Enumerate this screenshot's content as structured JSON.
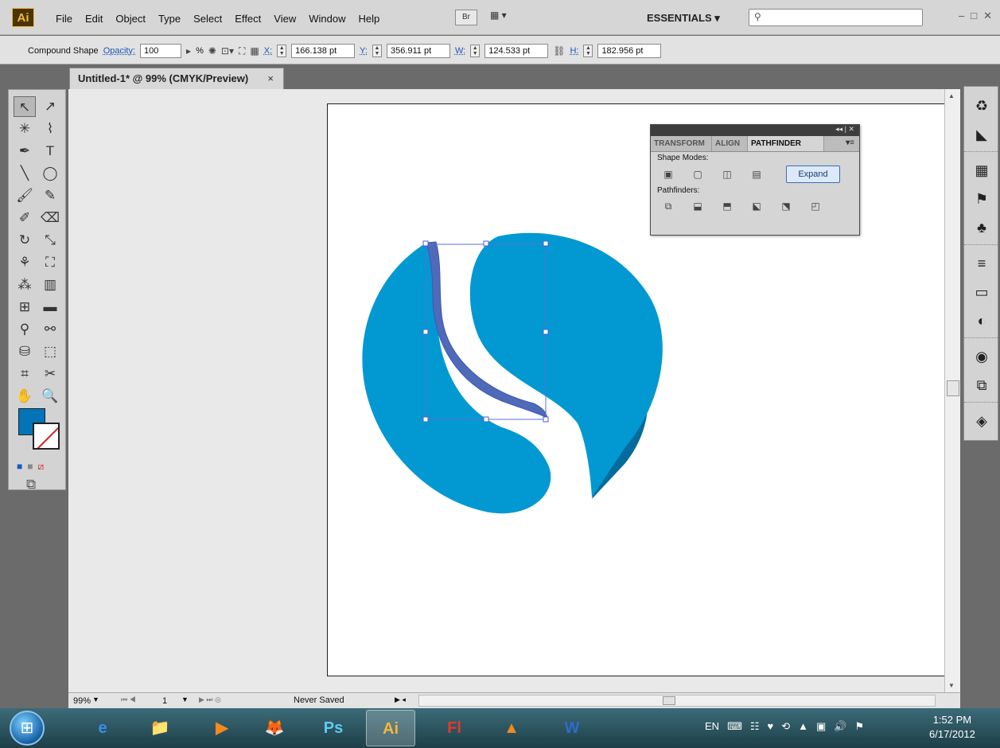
{
  "app": {
    "logo": "Ai"
  },
  "menus": [
    "File",
    "Edit",
    "Object",
    "Type",
    "Select",
    "Effect",
    "View",
    "Window",
    "Help"
  ],
  "menubar": {
    "bridge": "Br",
    "arrange": "▦ ▾",
    "workspace": "ESSENTIALS ▾",
    "search_placeholder": ""
  },
  "window_controls": [
    "–",
    "□",
    "✕"
  ],
  "control_bar": {
    "selection_type": "Compound Shape",
    "opacity_label": "Opacity:",
    "opacity_value": "100",
    "percent": "%",
    "x_label": "X:",
    "x_value": "166.138 pt",
    "y_label": "Y:",
    "y_value": "356.911 pt",
    "w_label": "W:",
    "w_value": "124.533 pt",
    "h_label": "H:",
    "h_value": "182.956 pt"
  },
  "document": {
    "tab_title": "Untitled-1* @ 99% (CMYK/Preview)",
    "close": "×"
  },
  "tools": [
    {
      "name": "selection-tool",
      "glyph": "↖"
    },
    {
      "name": "direct-selection-tool",
      "glyph": "↗"
    },
    {
      "name": "magic-wand-tool",
      "glyph": "✳"
    },
    {
      "name": "lasso-tool",
      "glyph": "⌇"
    },
    {
      "name": "pen-tool",
      "glyph": "✒"
    },
    {
      "name": "type-tool",
      "glyph": "T"
    },
    {
      "name": "line-tool",
      "glyph": "╲"
    },
    {
      "name": "ellipse-tool",
      "glyph": "◯"
    },
    {
      "name": "paintbrush-tool",
      "glyph": "🖌"
    },
    {
      "name": "pencil-tool",
      "glyph": "✎"
    },
    {
      "name": "blob-brush-tool",
      "glyph": "✐"
    },
    {
      "name": "eraser-tool",
      "glyph": "⌫"
    },
    {
      "name": "rotate-tool",
      "glyph": "↻"
    },
    {
      "name": "scale-tool",
      "glyph": "⤡"
    },
    {
      "name": "warp-tool",
      "glyph": "⚘"
    },
    {
      "name": "free-transform-tool",
      "glyph": "⛶"
    },
    {
      "name": "symbol-sprayer-tool",
      "glyph": "⁂"
    },
    {
      "name": "graph-tool",
      "glyph": "▥"
    },
    {
      "name": "mesh-tool",
      "glyph": "⊞"
    },
    {
      "name": "gradient-tool",
      "glyph": "▬"
    },
    {
      "name": "eyedropper-tool",
      "glyph": "⚲"
    },
    {
      "name": "blend-tool",
      "glyph": "⚯"
    },
    {
      "name": "live-paint-tool",
      "glyph": "⛁"
    },
    {
      "name": "live-paint-selection-tool",
      "glyph": "⬚"
    },
    {
      "name": "artboard-tool",
      "glyph": "⌗"
    },
    {
      "name": "slice-tool",
      "glyph": "✂"
    },
    {
      "name": "hand-tool",
      "glyph": "✋"
    },
    {
      "name": "zoom-tool",
      "glyph": "🔍"
    }
  ],
  "right_dock": [
    "♻",
    "◣",
    "▦",
    "⚑",
    "♣",
    "≡",
    "▭",
    "◐",
    "◉",
    "⧉",
    "◈"
  ],
  "pathfinder": {
    "tabs": [
      "TRANSFORM",
      "ALIGN",
      "PATHFINDER"
    ],
    "shape_modes_label": "Shape Modes:",
    "expand_label": "Expand",
    "pathfinders_label": "Pathfinders:",
    "shape_mode_icons": [
      "▣",
      "▢",
      "◫",
      "▤"
    ],
    "pathfinder_icons": [
      "⧉",
      "⬓",
      "⬒",
      "⬕",
      "⬔",
      "◰"
    ]
  },
  "artwork": {
    "fill_color": "#0299d2",
    "side_color": "#046c9c",
    "fill_swatch": "#0474b8"
  },
  "status_bar": {
    "zoom": "99%",
    "page": "1",
    "status": "Never Saved"
  },
  "taskbar": {
    "apps": [
      {
        "name": "internet-explorer",
        "label": "e",
        "color": "#3a8ee8"
      },
      {
        "name": "windows-explorer",
        "label": "📁",
        "color": "#f2c25a"
      },
      {
        "name": "media-player",
        "label": "▶",
        "color": "#f28a1e"
      },
      {
        "name": "firefox",
        "label": "🦊",
        "color": "#f0922e"
      },
      {
        "name": "photoshop",
        "label": "Ps",
        "color": "#5ecbf5"
      },
      {
        "name": "illustrator",
        "label": "Ai",
        "color": "#f4b73d"
      },
      {
        "name": "flash",
        "label": "Fl",
        "color": "#e23a2a"
      },
      {
        "name": "vlc",
        "label": "▲",
        "color": "#f28a1e"
      },
      {
        "name": "word",
        "label": "W",
        "color": "#2e6cc8"
      }
    ],
    "language": "EN",
    "time": "1:52 PM",
    "date": "6/17/2012"
  }
}
